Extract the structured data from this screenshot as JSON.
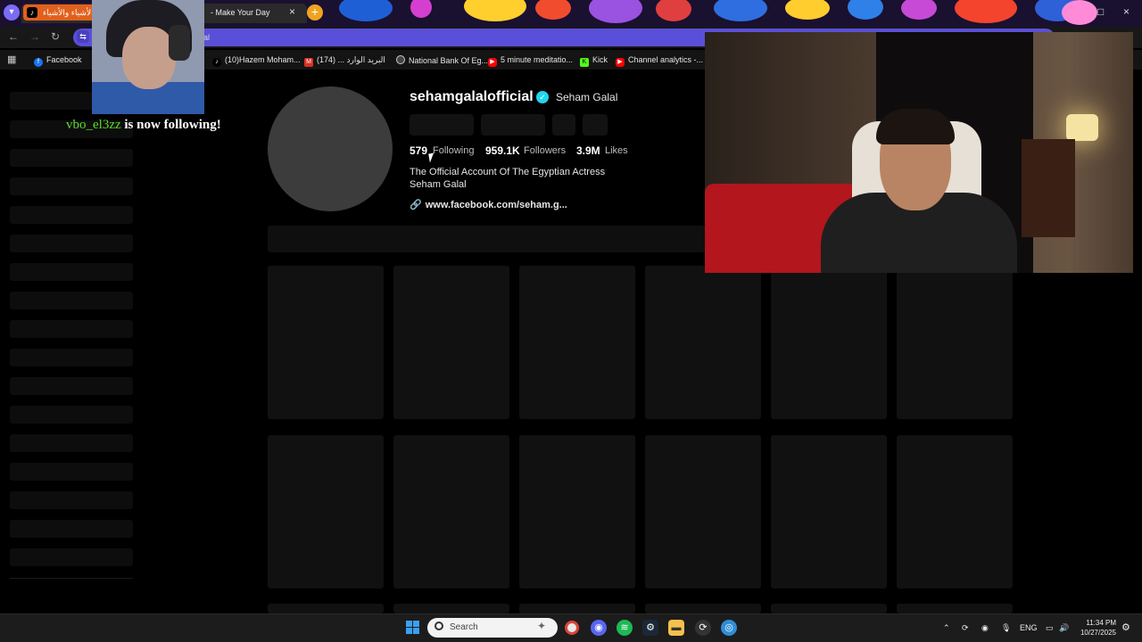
{
  "browser": {
    "tab_arabic_label": "الأشياء والأشياء |",
    "tab_title": "- Make Your Day",
    "tab_close": "×",
    "new_tab": "+",
    "url_fragment": "al",
    "nav_back": "←",
    "nav_forward": "→",
    "nav_reload": "↻",
    "window_minimize": "–",
    "window_maximize": "□",
    "window_close": "×"
  },
  "bookmarks": [
    {
      "label": "Facebook",
      "icon": "facebook-icon",
      "color": "#1877f2"
    },
    {
      "label": "(10)Hazem Moham...",
      "icon": "tiktok-icon",
      "color": "#000000"
    },
    {
      "label": "(174) ... البريد الوارد",
      "icon": "gmail-icon",
      "color": "#d93025"
    },
    {
      "label": "National Bank Of Eg...",
      "icon": "globe-icon",
      "color": "#444444"
    },
    {
      "label": "5 minute meditatio...",
      "icon": "youtube-icon",
      "color": "#ff0000"
    },
    {
      "label": "Kick",
      "icon": "kick-icon",
      "color": "#53fc18"
    },
    {
      "label": "Channel analytics -...",
      "icon": "youtube-icon",
      "color": "#ff0000"
    }
  ],
  "profile": {
    "username": "sehamgalalofficial",
    "display_name": "Seham Galal",
    "verified": true,
    "stats": [
      {
        "value": "579",
        "label": "Following"
      },
      {
        "value": "959.1K",
        "label": "Followers"
      },
      {
        "value": "3.9M",
        "label": "Likes"
      }
    ],
    "bio_line1": "The Official Account Of The Egyptian Actress",
    "bio_line2": "Seham Galal",
    "link": "www.facebook.com/seham.g..."
  },
  "alert": {
    "username": "vbo_el3zz",
    "message": "is now following!"
  },
  "taskbar": {
    "search_placeholder": "Search",
    "language": "ENG",
    "time": "11:34 PM",
    "date": "10/27/2025",
    "pinned_icons": [
      "chrome-icon",
      "discord-icon",
      "spotify-icon",
      "steam-icon",
      "file-explorer-icon",
      "settings-icon",
      "edge-icon"
    ]
  },
  "colors": {
    "accent_purple": "#5a4fd8",
    "verified_blue": "#20d5ec",
    "alert_green": "#5cdd2a",
    "tab_orange": "#e2601d"
  }
}
